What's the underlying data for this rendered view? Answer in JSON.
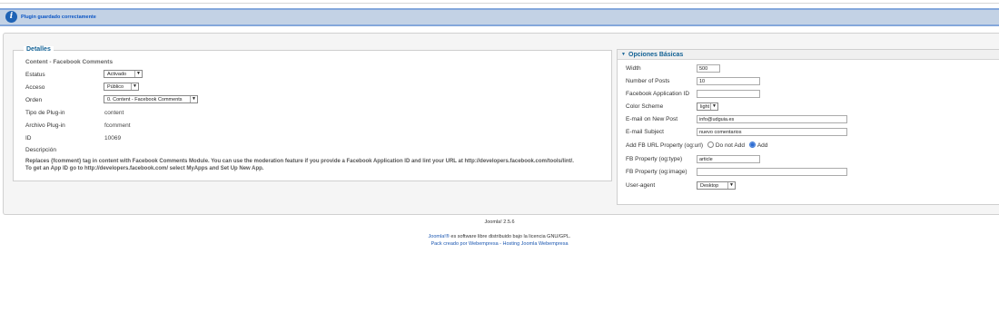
{
  "message": {
    "text": "Plugin guardado correctamente",
    "icon": "info-icon"
  },
  "details": {
    "legend": "Detalles",
    "subtitle": "Content - Facebook Comments",
    "estatus_label": "Estatus",
    "estatus_value": "Activado",
    "acceso_label": "Acceso",
    "acceso_value": "Público",
    "orden_label": "Orden",
    "orden_value": "0. Content - Facebook Comments",
    "tipo_label": "Tipo de Plug-in",
    "tipo_value": "content",
    "archivo_label": "Archivo Plug-in",
    "archivo_value": "fcomment",
    "id_label": "ID",
    "id_value": "10069",
    "descripcion_label": "Descripción",
    "description_line1": "Replaces {fcomment} tag in content with Facebook Comments Module. You can use the moderation feature if you provide a Facebook Application ID and lint your URL at http://developers.facebook.com/tools/lint/.",
    "description_line2": "To get an App ID go to http://developers.facebook.com/ select MyApps and Set Up New App."
  },
  "basic_options": {
    "title": "Opciones Básicas",
    "width_label": "Width",
    "width_value": "500",
    "posts_label": "Number of Posts",
    "posts_value": "10",
    "appid_label": "Facebook Application ID",
    "appid_value": "",
    "scheme_label": "Color Scheme",
    "scheme_value": "light",
    "email_label": "E-mail on New Post",
    "email_value": "info@udguia.es",
    "subject_label": "E-mail Subject",
    "subject_value": "nuevo comentarios",
    "ogurl_label": "Add FB URL Property (og:url)",
    "ogurl_option_no": "Do not Add",
    "ogurl_option_yes": "Add",
    "ogtype_label": "FB Property (og:type)",
    "ogtype_value": "article",
    "ogimage_label": "FB Property (og:image)",
    "ogimage_value": "",
    "agent_label": "User-agent",
    "agent_value": "Desktop"
  },
  "footer": {
    "version": "Joomla! 2.5.6",
    "license_link": "Joomla!®",
    "license_text": " es software libre distribuido bajo la licencia GNU/GPL.",
    "credits": "Pack creado por Webempresa - Hosting Joomla Webempresa"
  }
}
